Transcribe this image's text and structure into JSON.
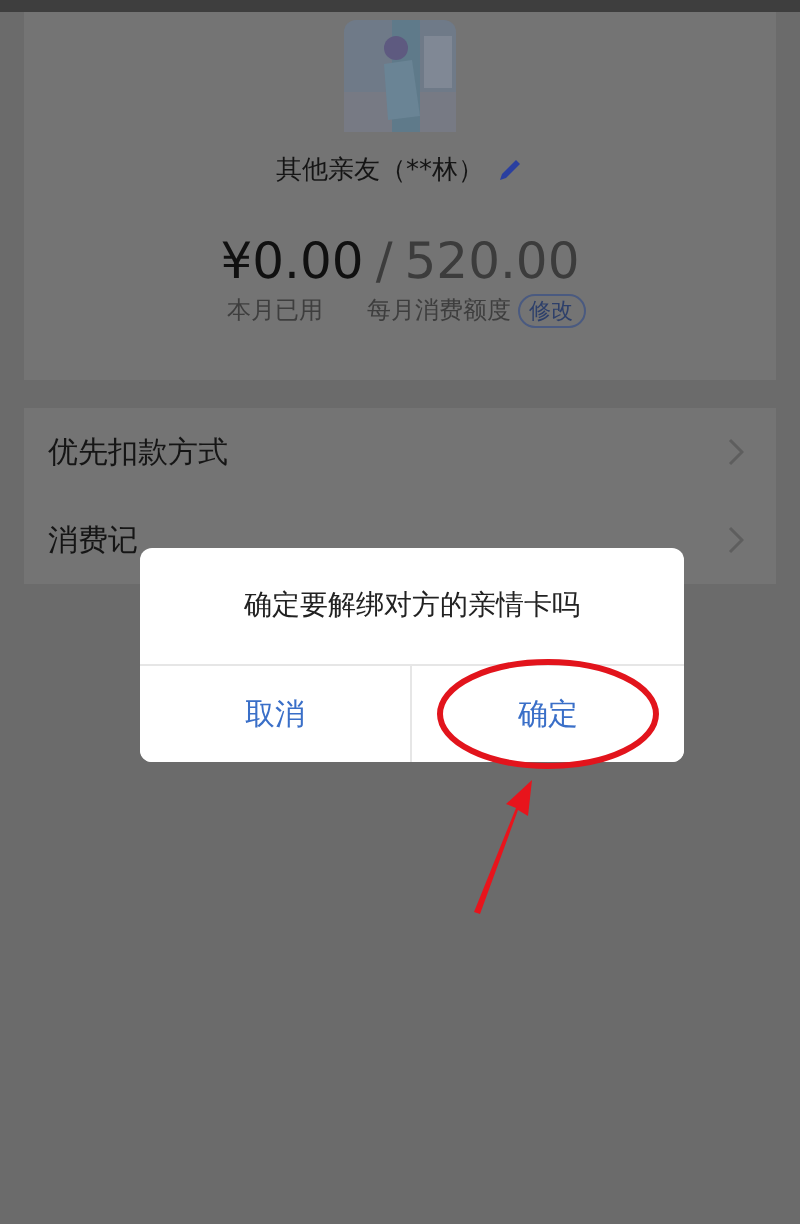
{
  "profile": {
    "name": "其他亲友（**林）",
    "spent": "¥0.00",
    "separator": "/",
    "limit": "520.00",
    "spent_label": "本月已用",
    "limit_label": "每月消费额度",
    "edit_limit": "修改"
  },
  "menu": [
    {
      "label": "优先扣款方式"
    },
    {
      "label": "消费记"
    }
  ],
  "dialog": {
    "message": "确定要解绑对方的亲情卡吗",
    "buttons": [
      {
        "label": "取消",
        "annotated": false
      },
      {
        "label": "确定",
        "annotated": true
      }
    ]
  }
}
